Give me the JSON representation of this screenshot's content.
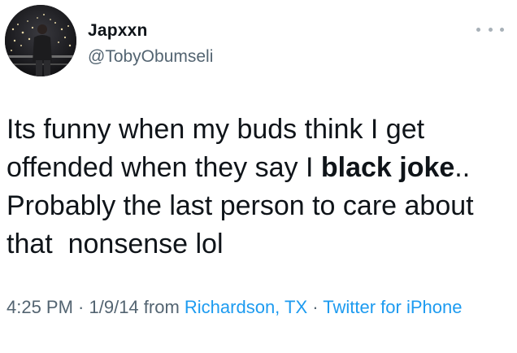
{
  "tweet": {
    "display_name": "Japxxn",
    "handle": "@TobyObumseli",
    "more_icon": "more-horizontal-icon",
    "avatar_icon": "profile-photo",
    "text_before_bold": "Its funny when my buds think I get offended when they say I ",
    "text_bold": "black joke",
    "text_after_bold": "..\nProbably the last person to care about that  nonsense lol",
    "time": "4:25 PM",
    "separator": " · ",
    "date": "1/9/14",
    "from_label": " from ",
    "location": "Richardson, TX",
    "source": "Twitter for iPhone"
  },
  "colors": {
    "text": "#0f1419",
    "secondary": "#536471",
    "link": "#1d9bf0"
  }
}
